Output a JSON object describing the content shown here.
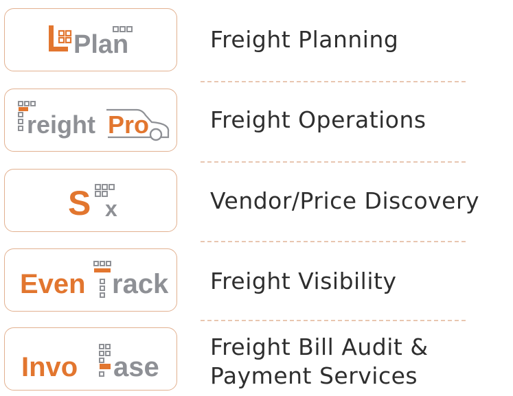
{
  "colors": {
    "accent": "#e2762f",
    "logo_gray": "#8e9095",
    "card_border": "#e2b08f",
    "text": "#2e2e2e",
    "divider": "#e8c6b0"
  },
  "products": [
    {
      "logo": {
        "lead": "L",
        "text": "Plan"
      },
      "service": "Freight Planning"
    },
    {
      "logo": {
        "lead": "F",
        "text_gray": "reight",
        "text_accent": "Pro"
      },
      "service": "Freight Operations"
    },
    {
      "logo": {
        "lead": "S",
        "text": "x"
      },
      "service": "Vendor/Price Discovery"
    },
    {
      "logo": {
        "lead": "Even",
        "text": "rack"
      },
      "service": "Freight Visibility"
    },
    {
      "logo": {
        "lead": "Invo",
        "text": "ase"
      },
      "service_line1": "Freight Bill Audit &",
      "service_line2": "Payment Services"
    }
  ]
}
